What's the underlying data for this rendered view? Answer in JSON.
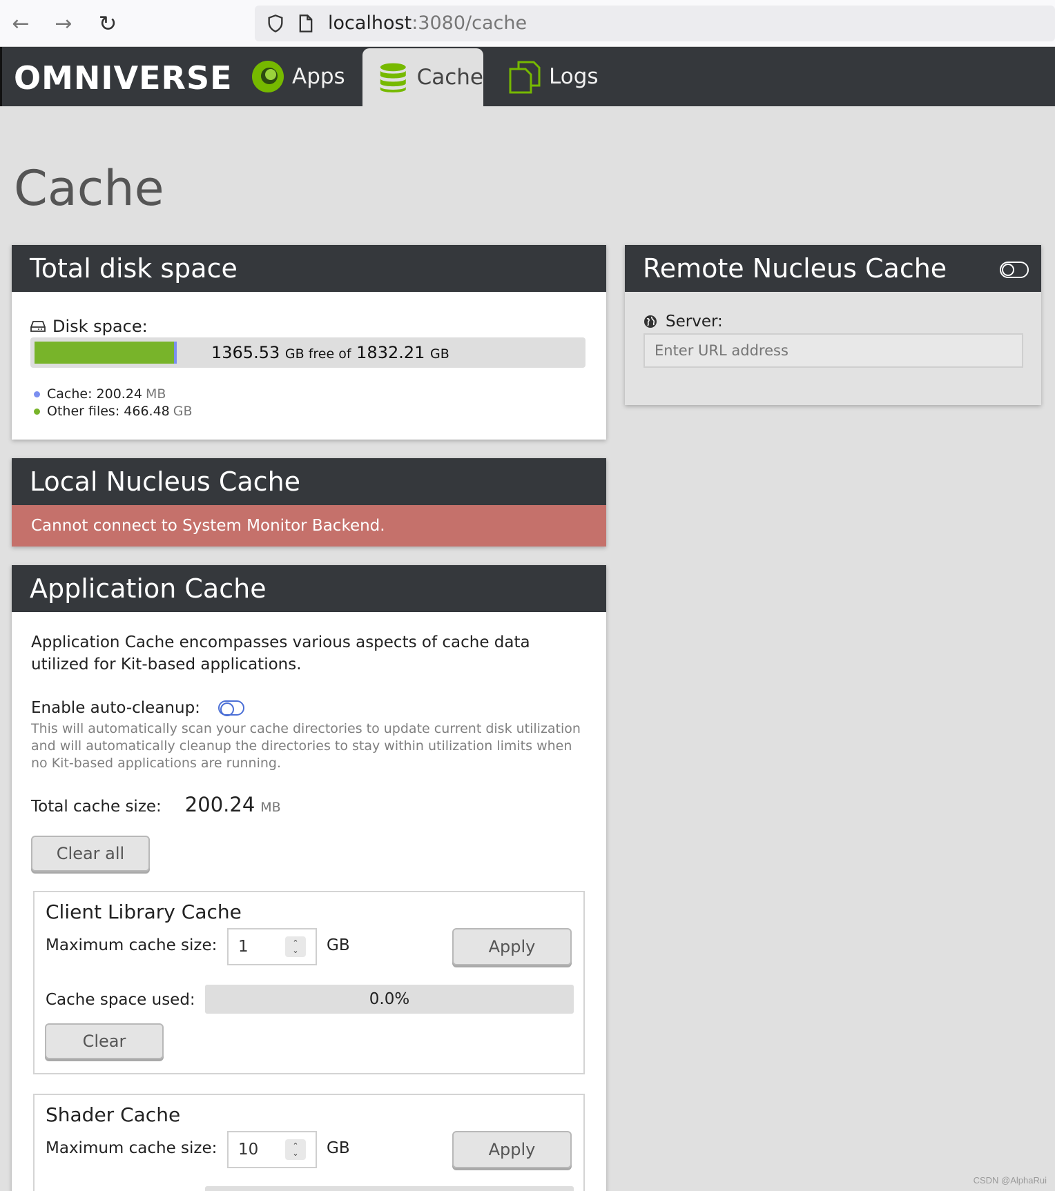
{
  "browser": {
    "back_icon": "←",
    "forward_icon": "→",
    "reload_icon": "↻",
    "url_host": "localhost",
    "url_rest": ":3080/cache"
  },
  "header": {
    "logo": "OMNIVERSE",
    "tabs": [
      {
        "label": "Apps",
        "icon": "apps-icon",
        "active": false
      },
      {
        "label": "Cache",
        "icon": "database-icon",
        "active": true
      },
      {
        "label": "Logs",
        "icon": "logs-icon",
        "active": false
      }
    ],
    "accent_color": "#76b900"
  },
  "page": {
    "title": "Cache"
  },
  "disk": {
    "heading": "Total disk space",
    "label": "Disk space:",
    "free_value": "1365.53",
    "free_unit": "GB free of",
    "total_value": "1832.21",
    "total_unit": "GB",
    "used_fraction": 0.255,
    "cache_fraction": 0.0001,
    "legend": [
      {
        "label": "Cache: 200.24",
        "unit": "MB",
        "color": "#7b8ff0"
      },
      {
        "label": "Other files: 466.48",
        "unit": "GB",
        "color": "#78b42a"
      }
    ]
  },
  "remote": {
    "heading": "Remote Nucleus Cache",
    "server_label": "Server:",
    "server_placeholder": "Enter URL address",
    "enabled": false
  },
  "local": {
    "heading": "Local Nucleus Cache",
    "error": "Cannot connect to System Monitor Backend."
  },
  "app_cache": {
    "heading": "Application Cache",
    "description": "Application Cache encompasses various aspects of cache data utilized for Kit-based applications.",
    "auto_cleanup_label": "Enable auto-cleanup:",
    "auto_cleanup_enabled": false,
    "auto_cleanup_note": "This will automatically scan your cache directories to update current disk utilization and will automatically cleanup the directories to stay within utilization limits when no Kit-based applications are running.",
    "total_label": "Total cache size:",
    "total_value": "200.24",
    "total_unit": "MB",
    "clear_all_label": "Clear all",
    "client": {
      "title": "Client Library Cache",
      "max_label": "Maximum cache size:",
      "max_value": "1",
      "unit": "GB",
      "apply_label": "Apply",
      "used_label": "Cache space used:",
      "used_value": "0.0%",
      "clear_label": "Clear"
    },
    "shader": {
      "title": "Shader Cache",
      "max_label": "Maximum cache size:",
      "max_value": "10",
      "unit": "GB",
      "apply_label": "Apply"
    }
  },
  "watermark": "CSDN @AlphaRui"
}
